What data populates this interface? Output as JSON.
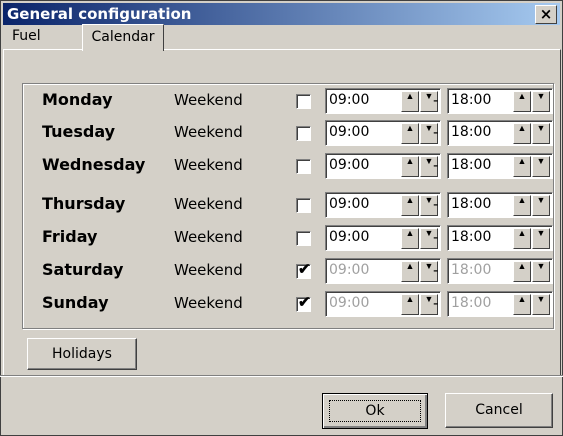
{
  "window": {
    "title": "General configuration",
    "close_glyph": "×"
  },
  "tabs": [
    {
      "label": "Fuel"
    },
    {
      "label": "Calendar"
    }
  ],
  "days": [
    {
      "name": "Monday",
      "weekend": "Weekend",
      "checked": false,
      "from": "09:00",
      "to": "18:00",
      "disabled": false
    },
    {
      "name": "Tuesday",
      "weekend": "Weekend",
      "checked": false,
      "from": "09:00",
      "to": "18:00",
      "disabled": false
    },
    {
      "name": "Wednesday",
      "weekend": "Weekend",
      "checked": false,
      "from": "09:00",
      "to": "18:00",
      "disabled": false
    },
    {
      "name": "Thursday",
      "weekend": "Weekend",
      "checked": false,
      "from": "09:00",
      "to": "18:00",
      "disabled": false
    },
    {
      "name": "Friday",
      "weekend": "Weekend",
      "checked": false,
      "from": "09:00",
      "to": "18:00",
      "disabled": false
    },
    {
      "name": "Saturday",
      "weekend": "Weekend",
      "checked": true,
      "from": "09:00",
      "to": "18:00",
      "disabled": true
    },
    {
      "name": "Sunday",
      "weekend": "Weekend",
      "checked": true,
      "from": "09:00",
      "to": "18:00",
      "disabled": true
    }
  ],
  "separator": "-",
  "check_glyph": "✔",
  "spin_up": "▲",
  "spin_down": "▼",
  "buttons": {
    "holidays": "Holidays",
    "ok": "Ok",
    "cancel": "Cancel"
  }
}
